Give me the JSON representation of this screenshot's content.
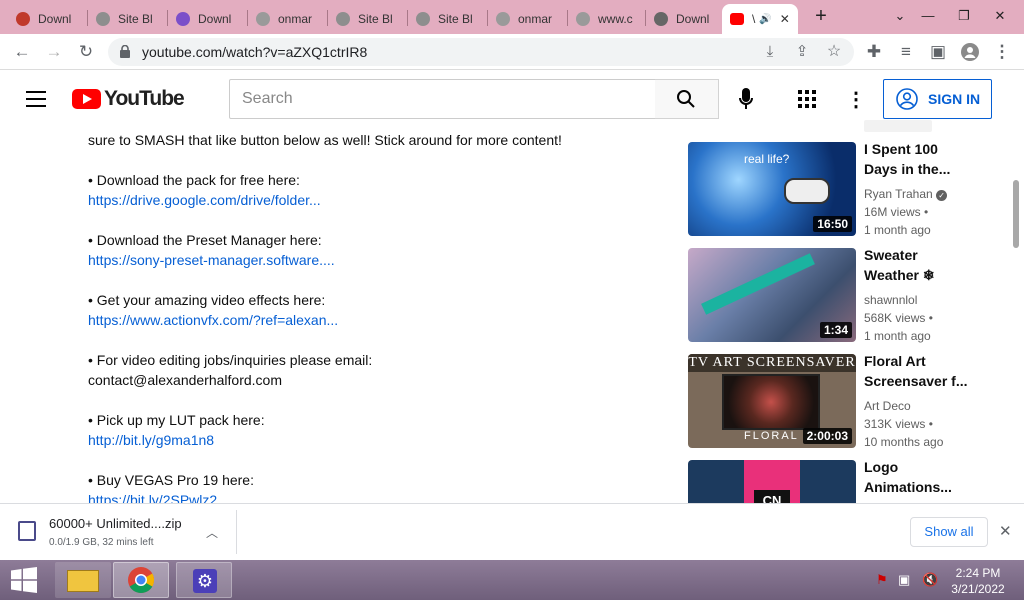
{
  "browser": {
    "tabs": [
      {
        "label": "Downl",
        "favicon_color": "#c0392b"
      },
      {
        "label": "Site Bl",
        "favicon_color": "#8e8e8e"
      },
      {
        "label": "Downl",
        "favicon_color": "#7b4fc9"
      },
      {
        "label": "onmar",
        "favicon_color": "#9a9a9a"
      },
      {
        "label": "Site Bl",
        "favicon_color": "#8e8e8e"
      },
      {
        "label": "Site Bl",
        "favicon_color": "#8e8e8e"
      },
      {
        "label": "onmar",
        "favicon_color": "#9a9a9a"
      },
      {
        "label": "www.c",
        "favicon_color": "#9a9a9a"
      },
      {
        "label": "Downl",
        "favicon_color": "#666666"
      },
      {
        "label": "\\",
        "favicon_color": "#ff0000"
      }
    ],
    "url": "youtube.com/watch?v=aZXQ1ctrIR8",
    "tabstrip_color": "#e3adc0"
  },
  "youtube": {
    "logo_text": "YouTube",
    "search_placeholder": "Search",
    "signin_label": "SIGN IN"
  },
  "description": {
    "lines": [
      {
        "text": "sure to SMASH that like button below as well! Stick around for more content!",
        "link": false
      },
      {
        "text": "• Download the pack for free here:",
        "link": false
      },
      {
        "text": "https://drive.google.com/drive/folder...",
        "link": true
      },
      {
        "text": "• Download the Preset Manager here:",
        "link": false
      },
      {
        "text": "https://sony-preset-manager.software....",
        "link": true
      },
      {
        "text": "• Get your amazing video effects here:",
        "link": false
      },
      {
        "text": "https://www.actionvfx.com/?ref=alexan...",
        "link": true
      },
      {
        "text": "• For video editing jobs/inquiries please email:",
        "link": false
      },
      {
        "text": "contact@alexanderhalford.com",
        "link": false
      },
      {
        "text": "• Pick up my LUT pack here:",
        "link": false
      },
      {
        "text": "http://bit.ly/g9ma1n8",
        "link": true
      },
      {
        "text": "• Buy VEGAS Pro 19 here:",
        "link": false
      },
      {
        "text": "https://bit.ly/2SPwlz2",
        "link": true
      }
    ]
  },
  "related": [
    {
      "title": "I Spent 100 Days in the...",
      "channel": "Ryan Trahan",
      "verified": true,
      "views": "16M views",
      "age": "1 month ago",
      "duration": "16:50",
      "thumb_text": "real life?"
    },
    {
      "title": "Sweater Weather ❄",
      "channel": "shawnnlol",
      "verified": false,
      "views": "568K views",
      "age": "1 month ago",
      "duration": "1:34",
      "thumb_text": ""
    },
    {
      "title": "Floral Art Screensaver f...",
      "channel": "Art Deco",
      "verified": false,
      "views": "313K views",
      "age": "10 months ago",
      "duration": "2:00:03",
      "thumb_text": "TV ART SCREENSAVER",
      "thumb_text2": "FLORAL"
    },
    {
      "title": "Logo Animations...",
      "channel": "",
      "verified": false,
      "views": "",
      "age": "",
      "duration": "",
      "thumb_text": ""
    }
  ],
  "download": {
    "filename": "60000+ Unlimited....zip",
    "status": "0.0/1.9 GB, 32 mins left",
    "show_all_label": "Show all"
  },
  "taskbar": {
    "time": "2:24 PM",
    "date": "3/21/2022"
  }
}
